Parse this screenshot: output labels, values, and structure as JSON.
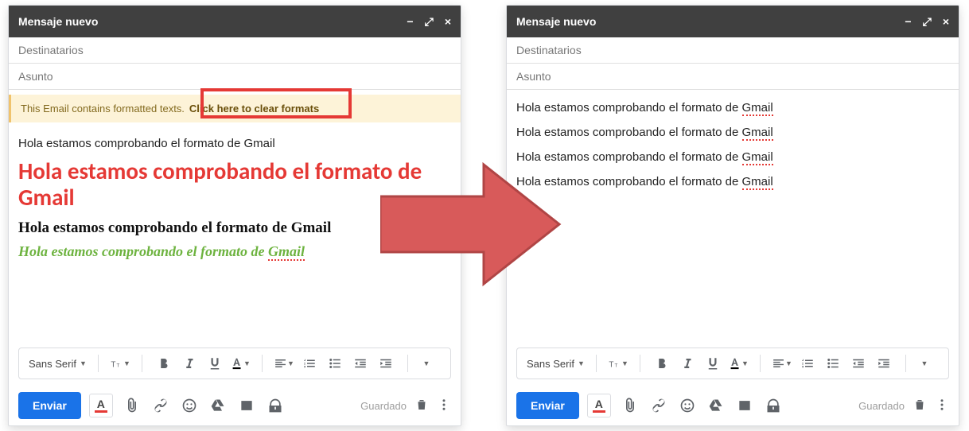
{
  "window_title": "Mensaje nuevo",
  "recipients_placeholder": "Destinatarios",
  "subject_placeholder": "Asunto",
  "warning_text": "This Email contains formatted texts.",
  "warning_link": "Click here to clear formats",
  "body_text_base": "Hola estamos comprobando el formato de",
  "body_text_last": "Gmail",
  "font_name": "Sans Serif",
  "send_label": "Enviar",
  "saved_label": "Guardado"
}
